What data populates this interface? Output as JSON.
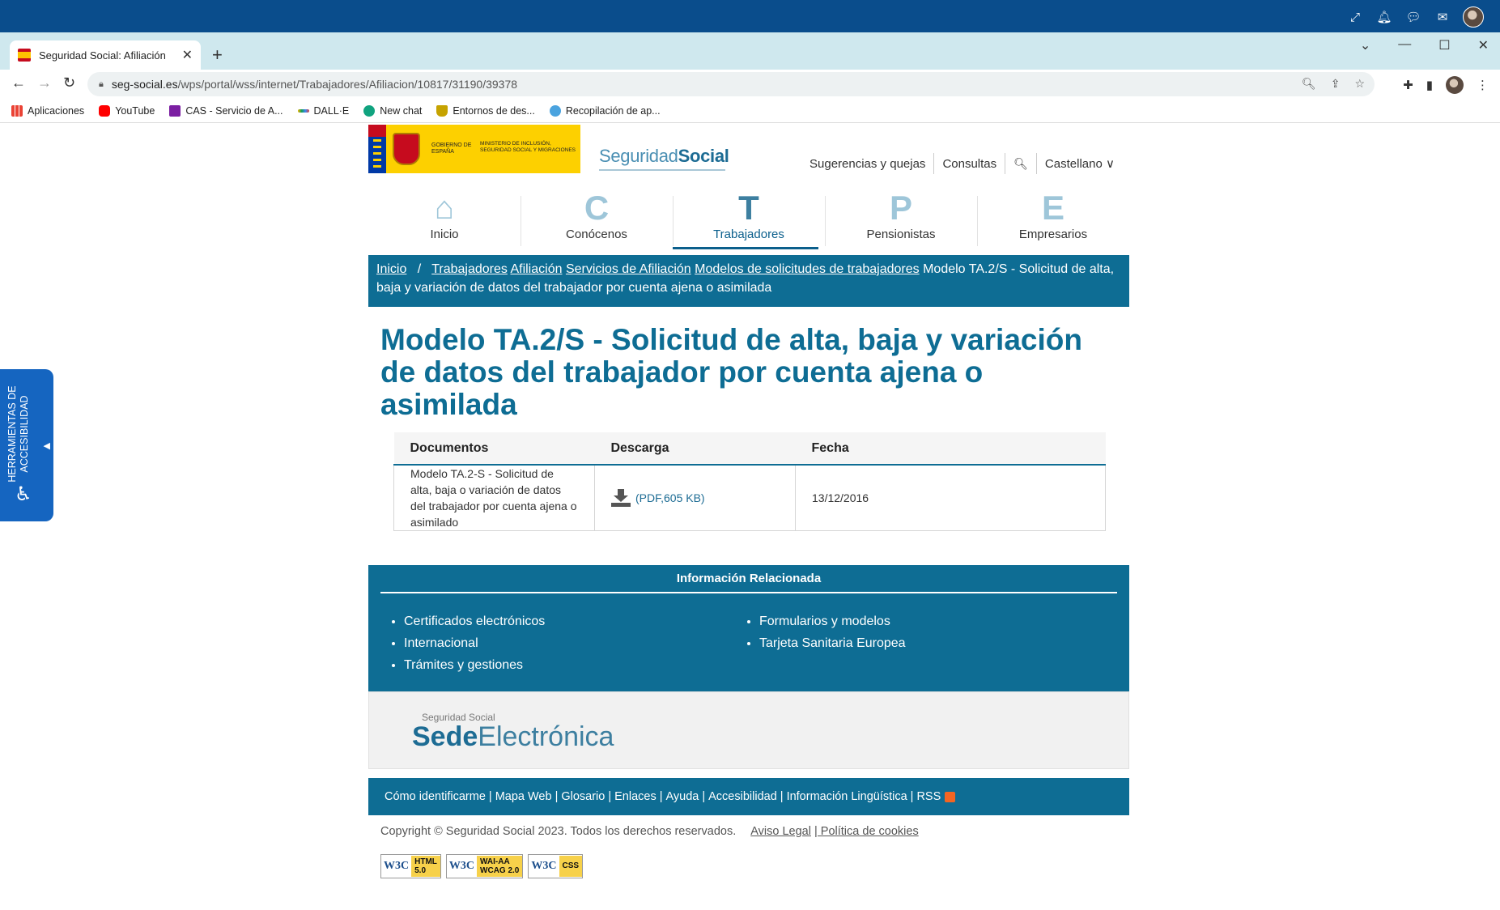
{
  "remote_desktop": {
    "icons": [
      "expand-icon",
      "bell-icon",
      "chat-icon",
      "mail-icon",
      "user-avatar"
    ]
  },
  "browser": {
    "tab_title": "Seguridad Social: Afiliación",
    "new_tab": "+",
    "url_host": "seg-social.es",
    "url_path": "/wps/portal/wss/internet/Trabajadores/Afiliacion/10817/31190/39378",
    "bookmarks": [
      {
        "label": "Aplicaciones",
        "color": "#4285f4"
      },
      {
        "label": "YouTube",
        "color": "#ff0000"
      },
      {
        "label": "CAS - Servicio de A...",
        "color": "#7b1fa2"
      },
      {
        "label": "DALL·E",
        "color": "#f4b400"
      },
      {
        "label": "New chat",
        "color": "#10a37f"
      },
      {
        "label": "Entornos de des...",
        "color": "#c6a300"
      },
      {
        "label": "Recopilación de ap...",
        "color": "#4aa3df"
      }
    ]
  },
  "accessibility": {
    "label": "HERRAMIENTAS DE ACCESIBILIDAD"
  },
  "header": {
    "logo_gobierno": "GOBIERNO DE ESPAÑA",
    "logo_ministerio": "MINISTERIO DE INCLUSIÓN, SEGURIDAD SOCIAL Y MIGRACIONES",
    "brand_light": "Seguridad",
    "brand_bold": "Social",
    "links": {
      "suggestions": "Sugerencias y quejas",
      "queries": "Consultas",
      "language": "Castellano ∨"
    }
  },
  "main_nav": [
    {
      "label": "Inicio",
      "glyph": "⌂"
    },
    {
      "label": "Conócenos",
      "glyph": "C"
    },
    {
      "label": "Trabajadores",
      "glyph": "T"
    },
    {
      "label": "Pensionistas",
      "glyph": "P"
    },
    {
      "label": "Empresarios",
      "glyph": "E"
    }
  ],
  "breadcrumb": {
    "home": "Inicio",
    "sep": "/",
    "items": [
      "Trabajadores",
      "Afiliación",
      "Servicios de Afiliación",
      "Modelos de solicitudes de trabajadores"
    ],
    "current": "Modelo TA.2/S - Solicitud de alta, baja y variación de datos del trabajador por cuenta ajena o asimilada"
  },
  "page": {
    "title": "Modelo TA.2/S - Solicitud de alta, baja y variación de datos del trabajador por cuenta ajena o asimilada"
  },
  "documents_table": {
    "headers": [
      "Documentos",
      "Descarga",
      "Fecha"
    ],
    "rows": [
      {
        "document": "Modelo TA.2-S - Solicitud de alta, baja o variación de datos del trabajador por cuenta ajena o asimilado",
        "download": "(PDF,605 KB)",
        "date": "13/12/2016"
      }
    ]
  },
  "related": {
    "title": "Información Relacionada",
    "col1": [
      "Certificados electrónicos",
      "Internacional",
      "Trámites y gestiones"
    ],
    "col2": [
      "Formularios y modelos",
      "Tarjeta Sanitaria Europea"
    ]
  },
  "sede": {
    "small": "Seguridad Social",
    "bold": "Sede",
    "light": "Electrónica"
  },
  "footer": {
    "links": [
      "Cómo identificarme",
      "Mapa Web",
      "Glosario",
      "Enlaces",
      "Ayuda",
      "Accesibilidad",
      "Información Lingüística",
      "RSS"
    ],
    "copyright": "Copyright © Seguridad Social 2023. Todos los derechos reservados.",
    "legal": "Aviso Legal",
    "cookies": "| Política de cookies",
    "badges": [
      {
        "w3": "W3C",
        "text1": "HTML",
        "text2": "5.0"
      },
      {
        "w3": "W3C",
        "text1": "WAI-AA",
        "text2": "WCAG 2.0"
      },
      {
        "w3": "W3C",
        "text1": "CSS",
        "text2": ""
      }
    ]
  }
}
